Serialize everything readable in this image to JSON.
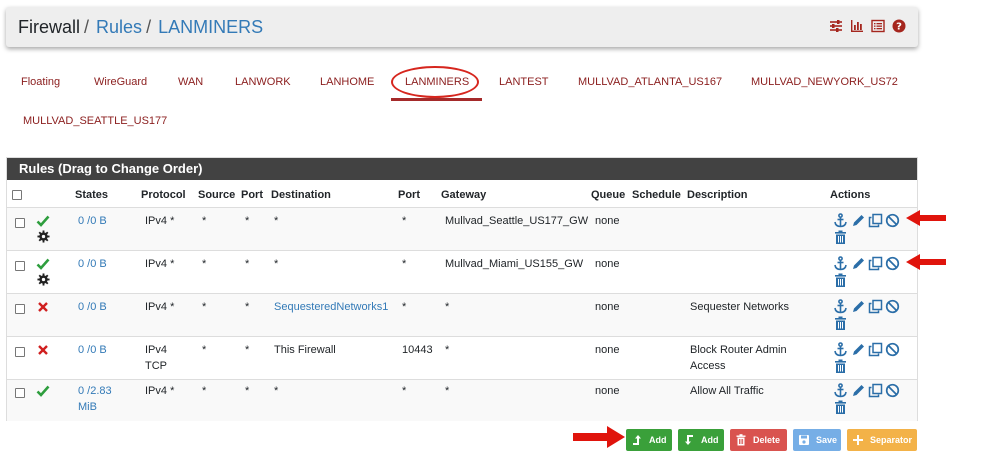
{
  "breadcrumb": {
    "root": "Firewall",
    "section": "Rules",
    "current": "LANMINERS",
    "separator": "/"
  },
  "header_icons": [
    "sliders-icon",
    "bar-chart-icon",
    "list-icon",
    "help-icon"
  ],
  "tabs": [
    {
      "label": "Floating"
    },
    {
      "label": "WireGuard"
    },
    {
      "label": "WAN"
    },
    {
      "label": "LANWORK"
    },
    {
      "label": "LANHOME"
    },
    {
      "label": "LANMINERS",
      "active": true
    },
    {
      "label": "LANTEST"
    },
    {
      "label": "MULLVAD_ATLANTA_US167"
    },
    {
      "label": "MULLVAD_NEWYORK_US72"
    },
    {
      "label": "MULLVAD_SEATTLE_US177"
    }
  ],
  "panel": {
    "title": "Rules (Drag to Change Order)"
  },
  "columns": {
    "states": "States",
    "protocol": "Protocol",
    "source": "Source",
    "port": "Port",
    "destination": "Destination",
    "dport": "Port",
    "gateway": "Gateway",
    "queue": "Queue",
    "schedule": "Schedule",
    "description": "Description",
    "actions": "Actions"
  },
  "rules": [
    {
      "status": "pass",
      "has_gear": true,
      "states": "0 /0 B",
      "protocol": "IPv4 *",
      "source": "*",
      "sport": "*",
      "destination": "*",
      "dport": "*",
      "gateway": "Mullvad_Seattle_US177_GW",
      "queue": "none",
      "schedule": "",
      "description": ""
    },
    {
      "status": "pass",
      "has_gear": true,
      "states": "0 /0 B",
      "protocol": "IPv4 *",
      "source": "*",
      "sport": "*",
      "destination": "*",
      "dport": "*",
      "gateway": "Mullvad_Miami_US155_GW",
      "queue": "none",
      "schedule": "",
      "description": ""
    },
    {
      "status": "block",
      "has_gear": false,
      "states": "0 /0 B",
      "protocol": "IPv4 *",
      "source": "*",
      "sport": "*",
      "destination": "SequesteredNetworks1",
      "dport": "*",
      "gateway": "*",
      "queue": "none",
      "schedule": "",
      "description": "Sequester Networks"
    },
    {
      "status": "block",
      "has_gear": false,
      "states": "0 /0 B",
      "protocol": "IPv4 TCP",
      "source": "*",
      "sport": "*",
      "destination": "This Firewall",
      "dport": "10443",
      "gateway": "*",
      "queue": "none",
      "schedule": "",
      "description": "Block Router Admin Access"
    },
    {
      "status": "pass",
      "has_gear": false,
      "states": "0 /2.83 MiB",
      "protocol": "IPv4 *",
      "source": "*",
      "sport": "*",
      "destination": "*",
      "dport": "*",
      "gateway": "*",
      "queue": "none",
      "schedule": "",
      "description": "Allow All Traffic"
    }
  ],
  "buttons": {
    "add_top": "Add",
    "add_bottom": "Add",
    "delete": "Delete",
    "save": "Save",
    "separator": "Separator"
  },
  "colors": {
    "pass": "#2e9e3e",
    "block": "#d01f1f",
    "link": "#337ab7",
    "tab": "#8b1e1e",
    "annotation": "#e0140c"
  }
}
